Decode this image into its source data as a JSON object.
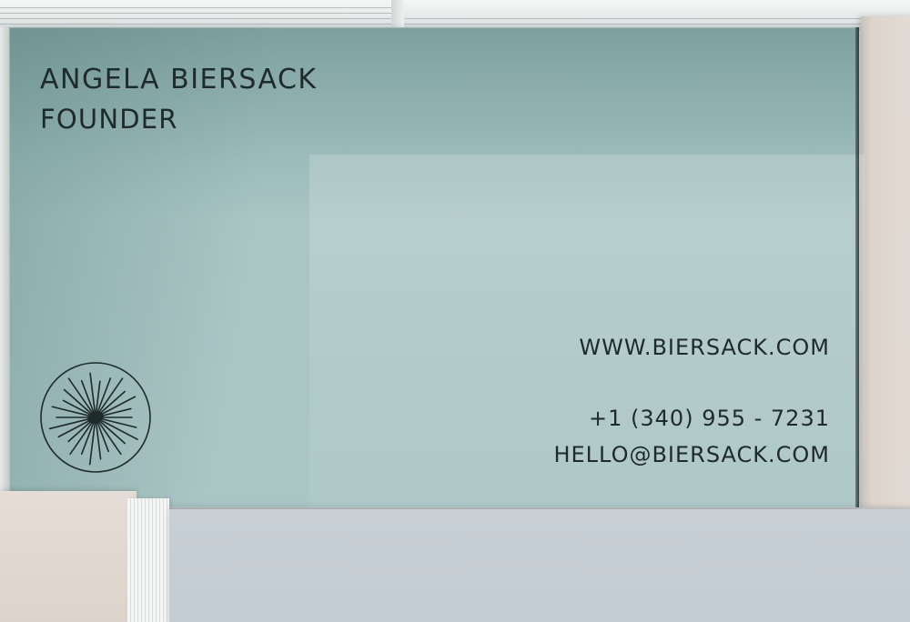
{
  "card": {
    "name": "ANGELA BIERSACK",
    "role": "FOUNDER",
    "website": "WWW.BIERSACK.COM",
    "phone": "+1 (340) 955 - 7231",
    "email": "HELLO@BIERSACK.COM"
  },
  "colors": {
    "card": "#a9c5c4",
    "ink": "#1f2a2a",
    "beige": "#dcd4cd",
    "blue_card": "#c6ced5"
  },
  "icons": {
    "logo": "sunburst-circle-icon"
  }
}
